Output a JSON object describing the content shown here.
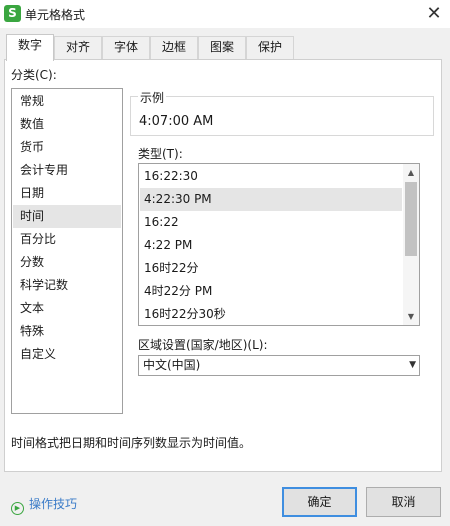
{
  "window": {
    "app_icon": "S",
    "title": "单元格格式",
    "close_glyph": "✕"
  },
  "tabs": [
    {
      "label": "数字",
      "active": true
    },
    {
      "label": "对齐"
    },
    {
      "label": "字体"
    },
    {
      "label": "边框"
    },
    {
      "label": "图案"
    },
    {
      "label": "保护"
    }
  ],
  "category": {
    "label": "分类(C):",
    "selected": "时间",
    "items": [
      "常规",
      "数值",
      "货币",
      "会计专用",
      "日期",
      "时间",
      "百分比",
      "分数",
      "科学记数",
      "文本",
      "特殊",
      "自定义"
    ]
  },
  "sample": {
    "label": "示例",
    "value": "4:07:00 AM"
  },
  "type": {
    "label": "类型(T):",
    "selected": "4:22:30 PM",
    "items": [
      "16:22:30",
      "4:22:30 PM",
      "16:22",
      "4:22 PM",
      "16时22分",
      "4时22分 PM",
      "16时22分30秒"
    ]
  },
  "locale": {
    "label": "区域设置(国家/地区)(L):",
    "value": "中文(中国)"
  },
  "description": "时间格式把日期和时间序列数显示为时间值。",
  "footer": {
    "tips_label": "操作技巧",
    "ok_label": "确定",
    "cancel_label": "取消"
  },
  "colors": {
    "accent": "#3f8ee0",
    "link": "#3a7bc8",
    "brand_green": "#3aa640",
    "selection": "#e5e5e5"
  }
}
